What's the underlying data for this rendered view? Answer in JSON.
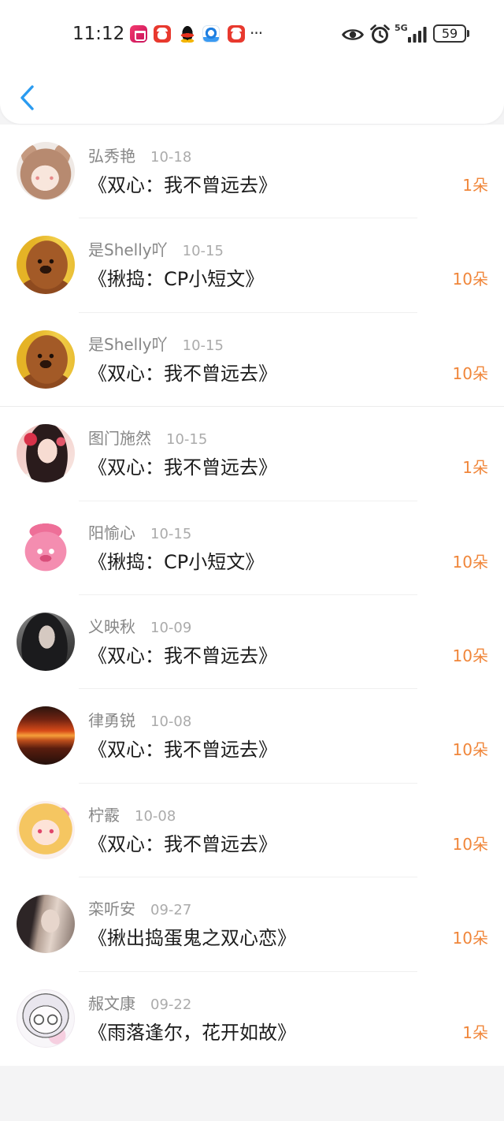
{
  "status_bar": {
    "time": "11:12",
    "app_icons": [
      "app-gallery-icon",
      "red-app-icon",
      "qq-icon",
      "blue-app-icon",
      "red-app-icon"
    ],
    "more": "···",
    "status_icons": [
      "eye-icon",
      "alarm-icon",
      "signal-icon",
      "battery-icon"
    ],
    "network": "5G",
    "battery": "59"
  },
  "header": {
    "back_icon": "chevron-left-icon"
  },
  "colors": {
    "accent": "#2a9bf0",
    "count": "#f0863a",
    "name": "#878787",
    "date": "#ababab",
    "title": "#1c1c1c",
    "page_bg": "#f4f4f5",
    "divider": "#f0f0f0"
  },
  "items": [
    {
      "name": "弘秀艳",
      "date": "10-18",
      "title": "《双心：我不曾远去》",
      "count": "1朵"
    },
    {
      "name": "是Shelly吖",
      "date": "10-15",
      "title": "《揪捣：CP小短文》",
      "count": "10朵"
    },
    {
      "name": "是Shelly吖",
      "date": "10-15",
      "title": "《双心：我不曾远去》",
      "count": "10朵"
    },
    {
      "name": "图门施然",
      "date": "10-15",
      "title": "《双心：我不曾远去》",
      "count": "1朵"
    },
    {
      "name": "阳愉心",
      "date": "10-15",
      "title": "《揪捣：CP小短文》",
      "count": "10朵"
    },
    {
      "name": "义映秋",
      "date": "10-09",
      "title": "《双心：我不曾远去》",
      "count": "10朵"
    },
    {
      "name": "律勇锐",
      "date": "10-08",
      "title": "《双心：我不曾远去》",
      "count": "10朵"
    },
    {
      "name": "柠霰",
      "date": "10-08",
      "title": "《双心：我不曾远去》",
      "count": "10朵"
    },
    {
      "name": "栾听安",
      "date": "09-27",
      "title": "《揪出捣蛋鬼之双心恋》",
      "count": "10朵"
    },
    {
      "name": "赧文康",
      "date": "09-22",
      "title": "《雨落逢尔，花开如故》",
      "count": "1朵"
    }
  ]
}
